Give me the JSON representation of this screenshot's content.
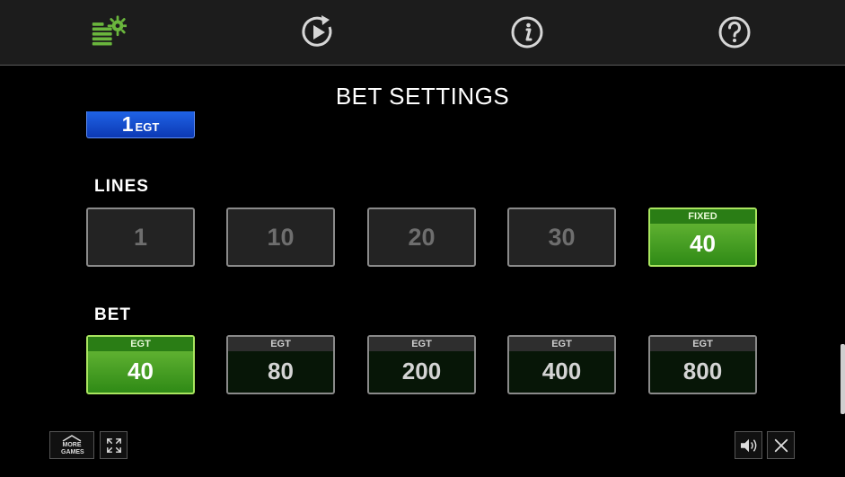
{
  "header": {
    "icons": [
      "bet-settings-icon",
      "autoplay-icon",
      "info-icon",
      "help-icon"
    ]
  },
  "title": "BET SETTINGS",
  "denomination": {
    "value": "1",
    "unit": "EGT"
  },
  "lines": {
    "label": "LINES",
    "options": [
      {
        "value": "1",
        "caption": "",
        "state": "disabled"
      },
      {
        "value": "10",
        "caption": "",
        "state": "disabled"
      },
      {
        "value": "20",
        "caption": "",
        "state": "disabled"
      },
      {
        "value": "30",
        "caption": "",
        "state": "disabled"
      },
      {
        "value": "40",
        "caption": "FIXED",
        "state": "selected"
      }
    ]
  },
  "bet": {
    "label": "BET",
    "options": [
      {
        "value": "40",
        "caption": "EGT",
        "state": "selected"
      },
      {
        "value": "80",
        "caption": "EGT",
        "state": "available"
      },
      {
        "value": "200",
        "caption": "EGT",
        "state": "available"
      },
      {
        "value": "400",
        "caption": "EGT",
        "state": "available"
      },
      {
        "value": "800",
        "caption": "EGT",
        "state": "available"
      }
    ]
  },
  "footer": {
    "more_games_label": "MORE GAMES",
    "icons": [
      "home-icon",
      "fullscreen-icon",
      "speaker-icon",
      "close-icon"
    ]
  },
  "colors": {
    "accent_green": "#6fbe3a",
    "denomination_blue": "#1f63e6",
    "topbar": "#1c1c1c"
  }
}
